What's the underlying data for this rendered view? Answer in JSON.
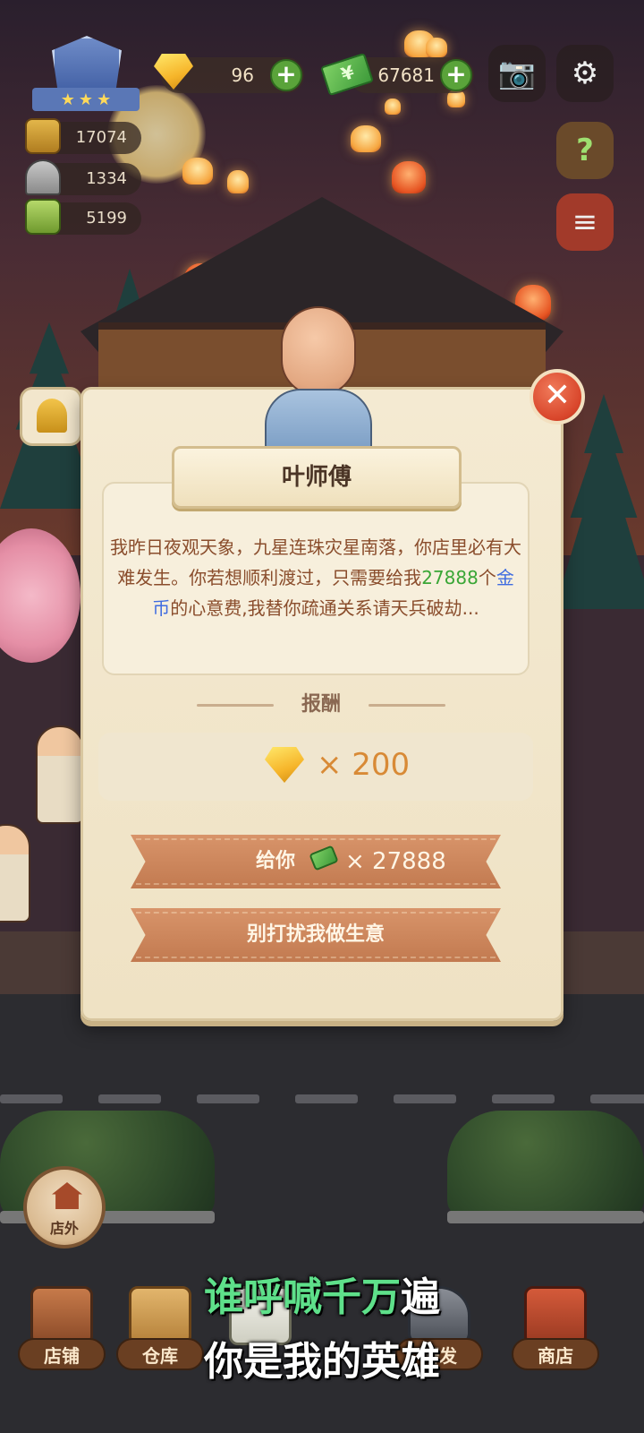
{
  "hud": {
    "gems": "96",
    "cash": "67681",
    "plus_symbol": "+",
    "resources": [
      {
        "icon": "gold-ingot-icon",
        "value": "17074"
      },
      {
        "icon": "cloche-icon",
        "value": "1334"
      },
      {
        "icon": "recipe-book-icon",
        "value": "5199"
      }
    ],
    "restaurant_rank_stars": 3,
    "camera_glyph": "📷",
    "settings_glyph": "⚙",
    "help_book_glyph": "?",
    "menu_book_glyph": "≡"
  },
  "dialog": {
    "npc_name": "叶师傅",
    "message_part1": "我昨日夜观天象，九星连珠灾星南落，你店里必有大难发生。你若想顺利渡过，只需要给我",
    "message_amount": "27888",
    "message_part2": "个",
    "message_currency": "金币",
    "message_part3": "的心意费,我替你疏通关系请天兵破劫...",
    "reward_header": "报酬",
    "reward_amount": "× 200",
    "pay_label": "给你",
    "pay_amount": "× 27888",
    "dismiss_label": "别打扰我做生意",
    "close_glyph": "✕"
  },
  "outside_button": {
    "label": "店外"
  },
  "nav": [
    {
      "id": "store",
      "label": "店铺",
      "icon": "storefront-icon"
    },
    {
      "id": "warehouse",
      "label": "仓库",
      "icon": "crate-icon"
    },
    {
      "id": "tasks",
      "label": "",
      "icon": "checklist-icon"
    },
    {
      "id": "research",
      "label": "研发",
      "icon": "wok-icon"
    },
    {
      "id": "shop",
      "label": "商店",
      "icon": "shop-stall-icon"
    }
  ],
  "subtitles": {
    "line1_highlight": "谁呼喊千万",
    "line1_rest": "遍",
    "line2": "你是我的英雄"
  },
  "colors": {
    "amount_green": "#3aa636",
    "currency_blue": "#3f6ce0",
    "message_brown": "#8a4d2c",
    "button_ribbon": "#c27a50",
    "subtitle_highlight": "#5ee08a"
  }
}
